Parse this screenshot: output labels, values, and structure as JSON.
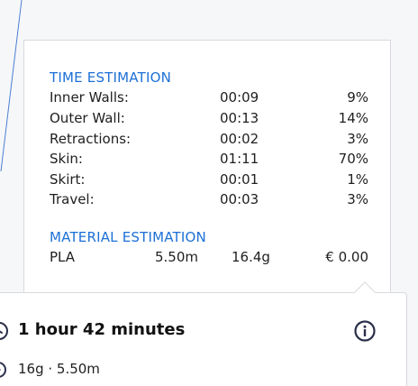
{
  "time_estimation": {
    "title": "TIME ESTIMATION",
    "rows": [
      {
        "label": "Inner Walls:",
        "time": "00:09",
        "percent": "9%"
      },
      {
        "label": "Outer Wall:",
        "time": "00:13",
        "percent": "14%"
      },
      {
        "label": "Retractions:",
        "time": "00:02",
        "percent": "3%"
      },
      {
        "label": "Skin:",
        "time": "01:11",
        "percent": "70%"
      },
      {
        "label": "Skirt:",
        "time": "00:01",
        "percent": "1%"
      },
      {
        "label": "Travel:",
        "time": "00:03",
        "percent": "3%"
      }
    ]
  },
  "material_estimation": {
    "title": "MATERIAL ESTIMATION",
    "rows": [
      {
        "name": "PLA",
        "length": "5.50m",
        "weight": "16.4g",
        "cost": "€ 0.00"
      }
    ]
  },
  "summary": {
    "print_time": "1 hour 42 minutes",
    "material": "16g · 5.50m"
  },
  "colors": {
    "accent": "#1d70d6",
    "text": "#1f1f1f",
    "icon_dark": "#2a2f4a",
    "border": "#d7d9de"
  },
  "icons": {
    "time": "clock-icon",
    "info": "info-icon",
    "material": "spool-icon"
  }
}
